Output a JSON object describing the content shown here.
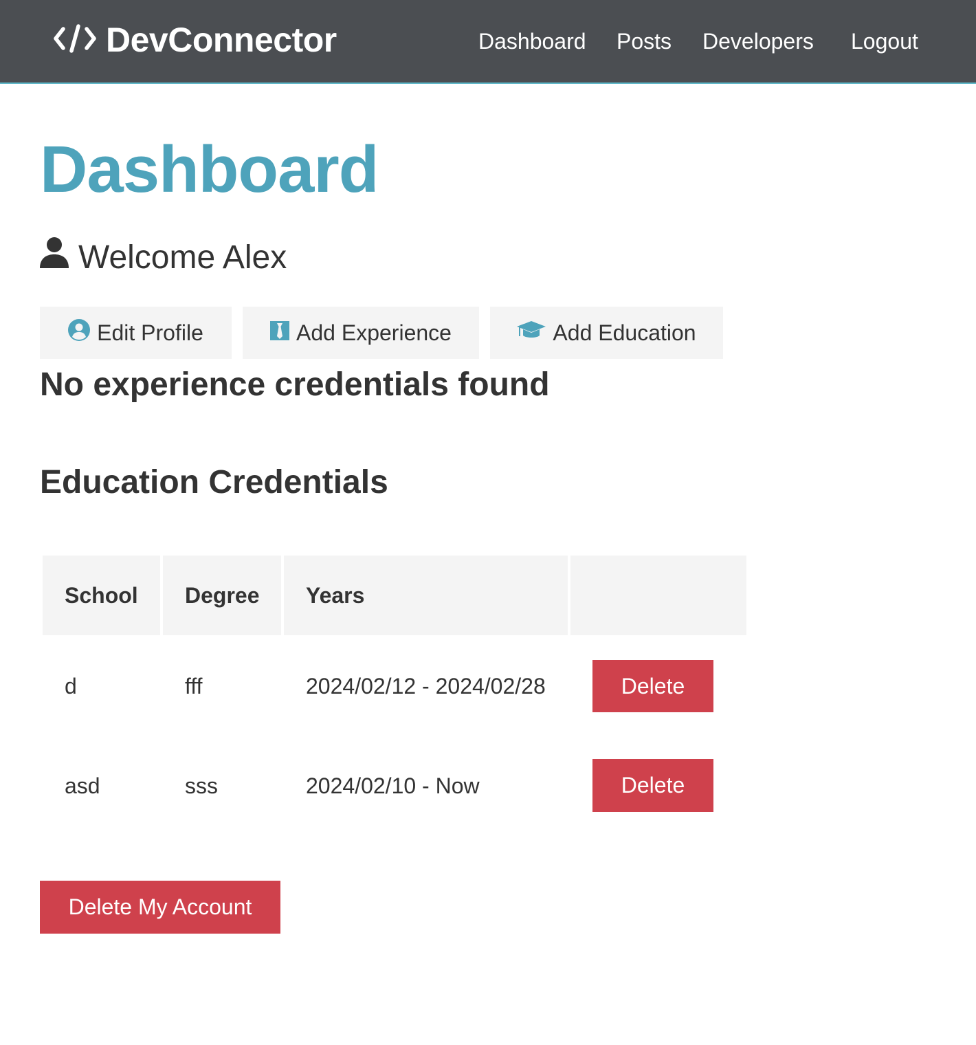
{
  "navbar": {
    "brand": "DevConnector",
    "brand_icon": "code-icon",
    "links": [
      "Dashboard",
      "Posts",
      "Developers",
      "Logout"
    ]
  },
  "page": {
    "title": "Dashboard",
    "welcome": "Welcome Alex",
    "welcome_icon": "user-icon"
  },
  "actions": [
    {
      "label": "Edit Profile",
      "icon": "user-circle-icon"
    },
    {
      "label": "Add Experience",
      "icon": "black-tie-icon"
    },
    {
      "label": "Add Education",
      "icon": "graduation-cap-icon"
    }
  ],
  "experience": {
    "empty_message": "No experience credentials found"
  },
  "education": {
    "title": "Education Credentials",
    "headers": [
      "School",
      "Degree",
      "Years",
      ""
    ],
    "rows": [
      {
        "school": "d",
        "degree": "fff",
        "years": "2024/02/12 - 2024/02/28",
        "action": "Delete"
      },
      {
        "school": "asd",
        "degree": "sss",
        "years": "2024/02/10 - Now",
        "action": "Delete"
      }
    ]
  },
  "account": {
    "delete_label": "Delete My Account"
  },
  "colors": {
    "navbar_bg": "#4b4e52",
    "primary": "#4ea3bb",
    "danger": "#cf414c",
    "light": "#f4f4f4",
    "text": "#333333"
  }
}
